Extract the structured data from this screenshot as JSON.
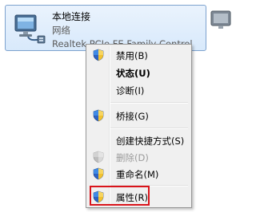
{
  "network_tile": {
    "name": "本地连接",
    "status": "网络",
    "adapter": "Realtek PCIe FE Family Control"
  },
  "context_menu": {
    "items": [
      {
        "label": "禁用(B)",
        "icon": "uac-shield-icon",
        "bold": false,
        "disabled": false
      },
      {
        "label": "状态(U)",
        "icon": "",
        "bold": true,
        "disabled": false
      },
      {
        "label": "诊断(I)",
        "icon": "",
        "bold": false,
        "disabled": false
      },
      {
        "label": "桥接(G)",
        "icon": "uac-shield-icon",
        "bold": false,
        "disabled": false
      },
      {
        "label": "创建快捷方式(S)",
        "icon": "",
        "bold": false,
        "disabled": false
      },
      {
        "label": "删除(D)",
        "icon": "uac-shield-icon",
        "bold": false,
        "disabled": true
      },
      {
        "label": "重命名(M)",
        "icon": "uac-shield-icon",
        "bold": false,
        "disabled": false
      },
      {
        "label": "属性(R)",
        "icon": "uac-shield-icon",
        "bold": false,
        "disabled": false
      }
    ]
  },
  "colors": {
    "highlight": "#d9141b",
    "tile_border": "#7da2ce",
    "menu_background": "#f0f0f0"
  }
}
